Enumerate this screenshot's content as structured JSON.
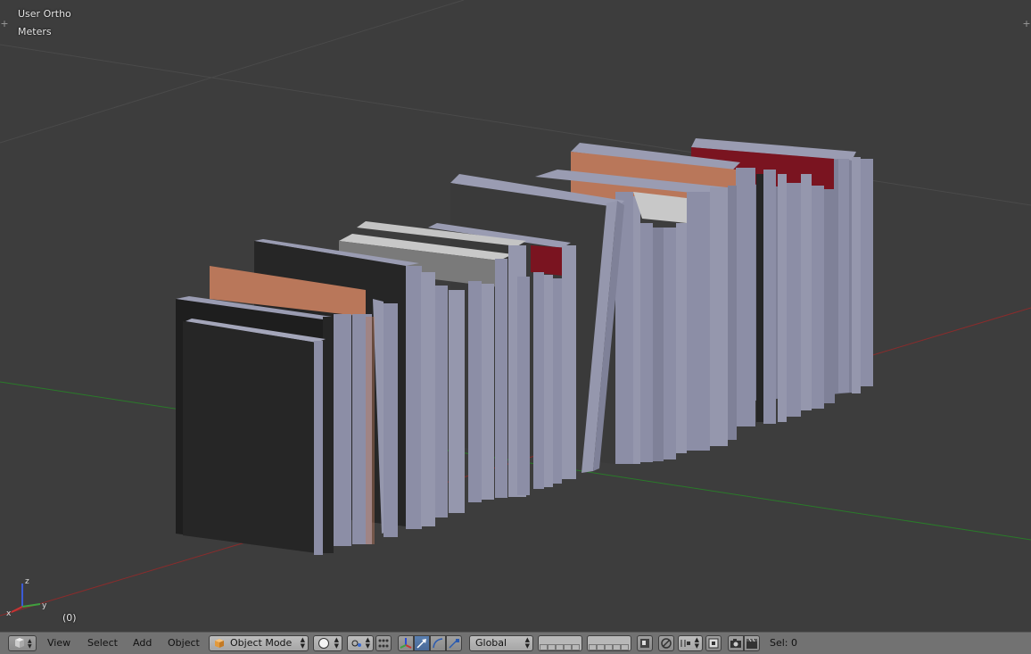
{
  "viewport": {
    "view_name": "User Ortho",
    "units": "Meters",
    "frame": "(0)",
    "axis_labels": {
      "z": "z",
      "y": "y",
      "x": "x"
    }
  },
  "header": {
    "menus": [
      "View",
      "Select",
      "Add",
      "Object"
    ],
    "mode": "Object Mode",
    "orientation": "Global",
    "selection": "Sel: 0"
  },
  "colors": {
    "background": "#3d3d3d",
    "header": "#727272",
    "x_axis": "#a3302e",
    "y_axis": "#2a8a2a",
    "book_gray": "#8c8ea6",
    "book_dark": "#262626",
    "book_orange": "#b9775a",
    "book_red": "#7a1420",
    "active_blue": "#5a7fb0"
  }
}
